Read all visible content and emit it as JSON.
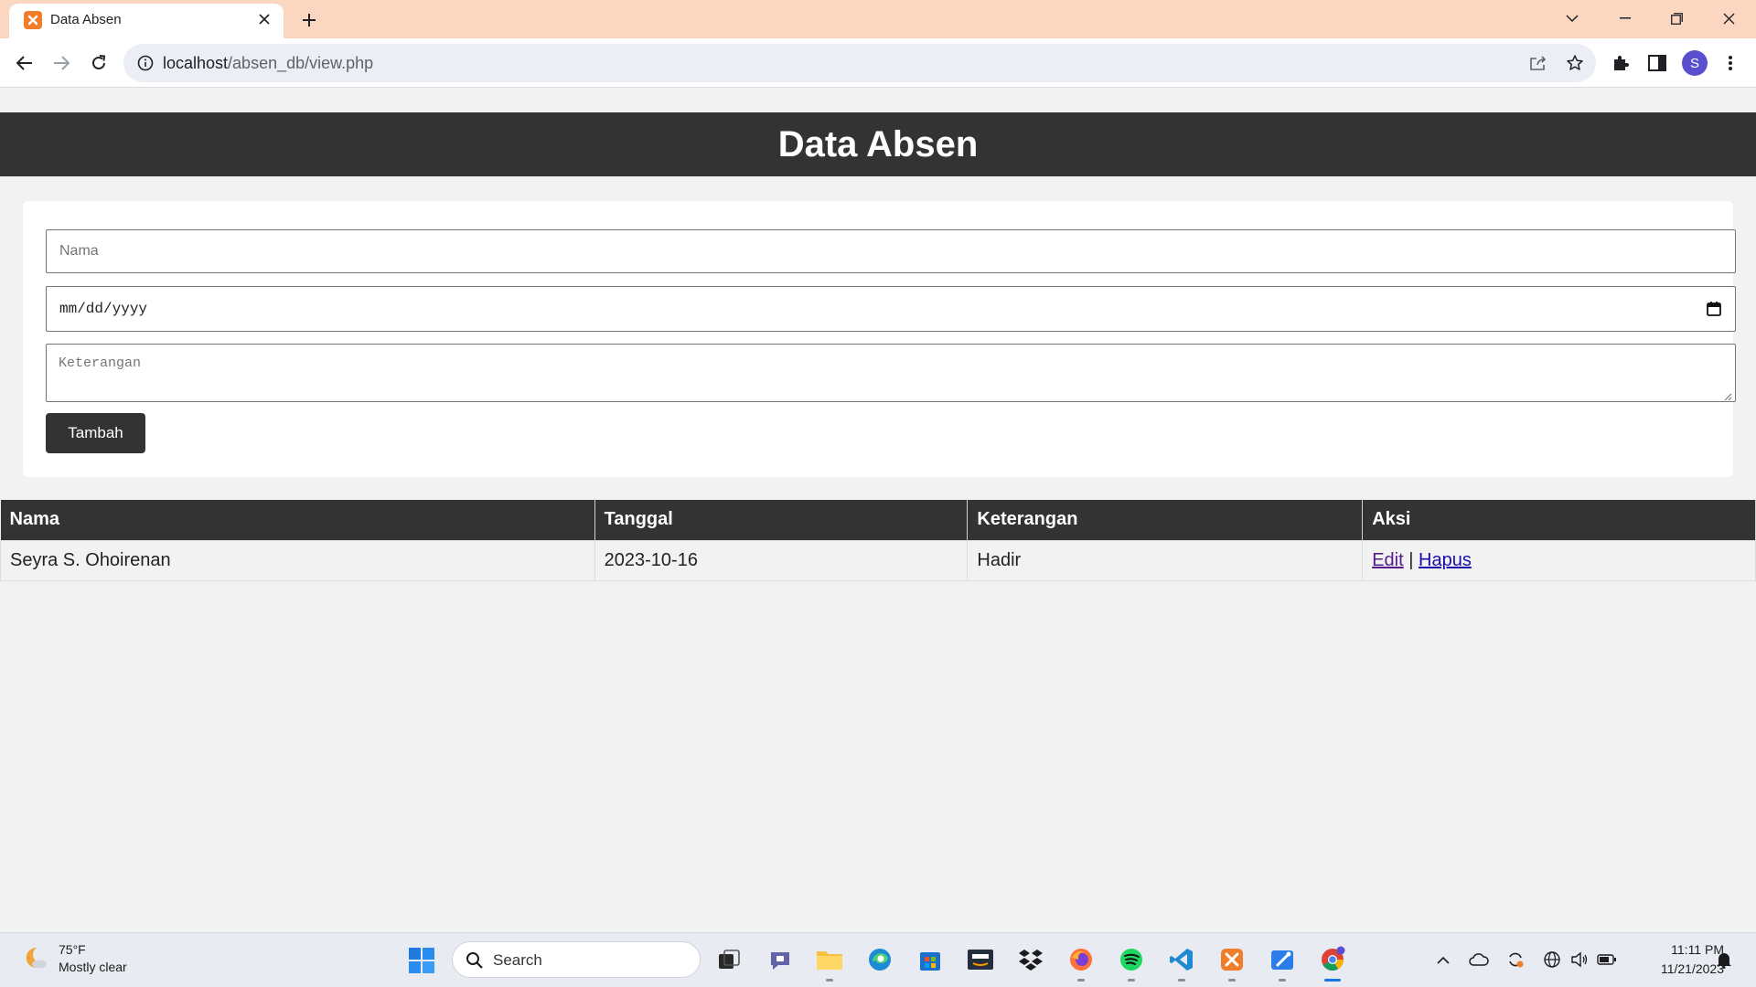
{
  "browser": {
    "tab_title": "Data Absen",
    "url_host": "localhost",
    "url_path": "/absen_db/view.php"
  },
  "page": {
    "title": "Data Absen",
    "form": {
      "nama_placeholder": "Nama",
      "date_placeholder": "mm/dd/yyyy",
      "keterangan_placeholder": "Keterangan",
      "submit_label": "Tambah"
    },
    "table": {
      "headers": [
        "Nama",
        "Tanggal",
        "Keterangan",
        "Aksi"
      ],
      "rows": [
        {
          "nama": "Seyra S. Ohoirenan",
          "tanggal": "2023-10-16",
          "keterangan": "Hadir",
          "edit_label": "Edit",
          "separator": "|",
          "hapus_label": "Hapus"
        }
      ]
    }
  },
  "taskbar": {
    "weather_temp": "75°F",
    "weather_desc": "Mostly clear",
    "search_label": "Search",
    "time": "11:11 PM",
    "date": "11/21/2023",
    "avatar_letter": "S"
  },
  "colors": {
    "header_bg": "#333333",
    "title_bar": "#fbd6c0",
    "link": "#1a0dab",
    "link_visited": "#551a8b"
  }
}
